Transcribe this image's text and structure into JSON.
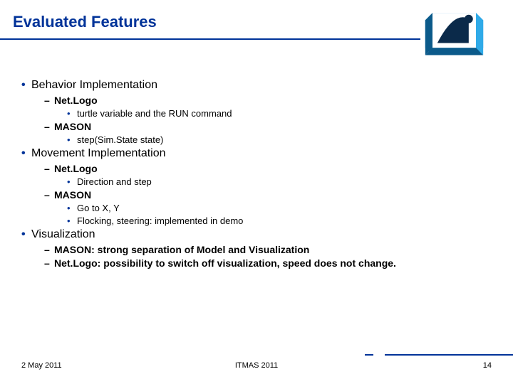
{
  "title": "Evaluated Features",
  "sections": {
    "s1": {
      "heading": "Behavior Implementation",
      "a": {
        "name": "Net.Logo",
        "items": [
          "turtle variable and the RUN command"
        ]
      },
      "b": {
        "name": "MASON",
        "items": [
          "step(Sim.State state)"
        ]
      }
    },
    "s2": {
      "heading": "Movement Implementation",
      "a": {
        "name": "Net.Logo",
        "items": [
          "Direction and step"
        ]
      },
      "b": {
        "name": "MASON",
        "items": [
          "Go to X, Y",
          "Flocking, steering: implemented in demo"
        ]
      }
    },
    "s3": {
      "heading": "Visualization",
      "items": [
        "MASON: strong separation of Model and Visualization",
        "Net.Logo: possibility to switch off visualization, speed does not change."
      ]
    }
  },
  "footer": {
    "date": "2 May 2011",
    "venue": "ITMAS 2011",
    "page": "14"
  }
}
